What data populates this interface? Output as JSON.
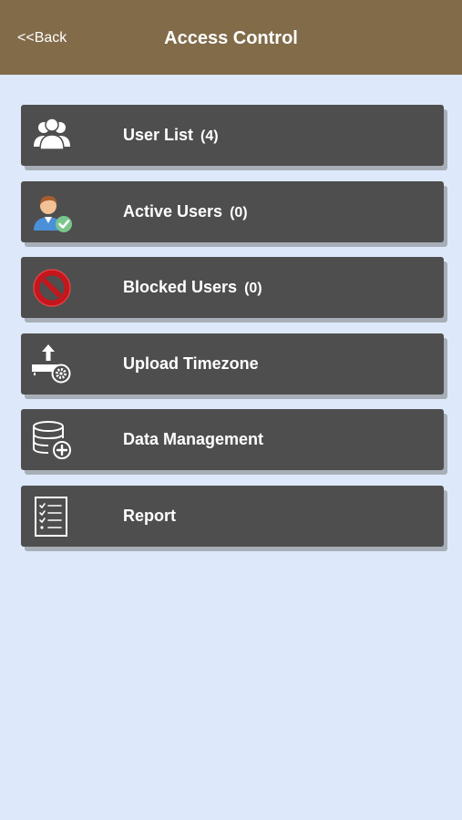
{
  "header": {
    "back_label": "<<Back",
    "title": "Access Control"
  },
  "menu": {
    "items": [
      {
        "label": "User List",
        "count": "(4)",
        "icon": "users-group-icon"
      },
      {
        "label": "Active Users",
        "count": "(0)",
        "icon": "user-check-icon"
      },
      {
        "label": "Blocked Users",
        "count": "(0)",
        "icon": "blocked-icon"
      },
      {
        "label": "Upload Timezone",
        "count": "",
        "icon": "upload-timezone-icon"
      },
      {
        "label": "Data Management",
        "count": "",
        "icon": "database-add-icon"
      },
      {
        "label": "Report",
        "count": "",
        "icon": "report-checklist-icon"
      }
    ]
  },
  "colors": {
    "header_bg": "#826b49",
    "page_bg": "#dde9fb",
    "item_bg": "#4e4e4e",
    "blocked_red": "#d61f26",
    "active_green": "#79c58b"
  }
}
